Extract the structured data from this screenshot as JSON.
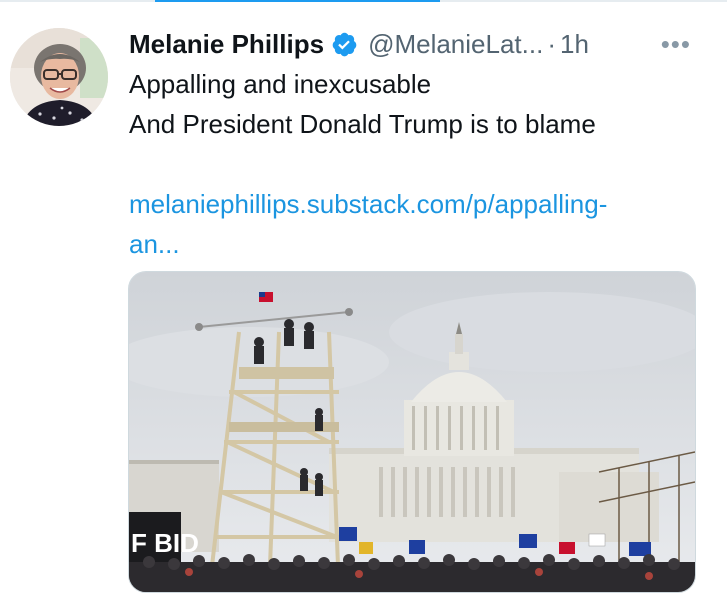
{
  "tweet": {
    "display_name": "Melanie Phillips",
    "verified_icon": "verified-badge-icon",
    "handle": "@MelanieLat...",
    "separator": "·",
    "timestamp": "1h",
    "more_icon": "more-options-icon",
    "text_lines": [
      "Appalling and inexcusable",
      "And President Donald Trump is to blame"
    ],
    "link_text": "melaniephillips.substack.com/p/appalling-an...",
    "media": {
      "icon": "photo-icon",
      "banner_text": "F BID"
    }
  },
  "colors": {
    "link": "#1b95e0",
    "verified": "#1d9bf0",
    "muted": "#536471",
    "border": "#cfd9de"
  }
}
